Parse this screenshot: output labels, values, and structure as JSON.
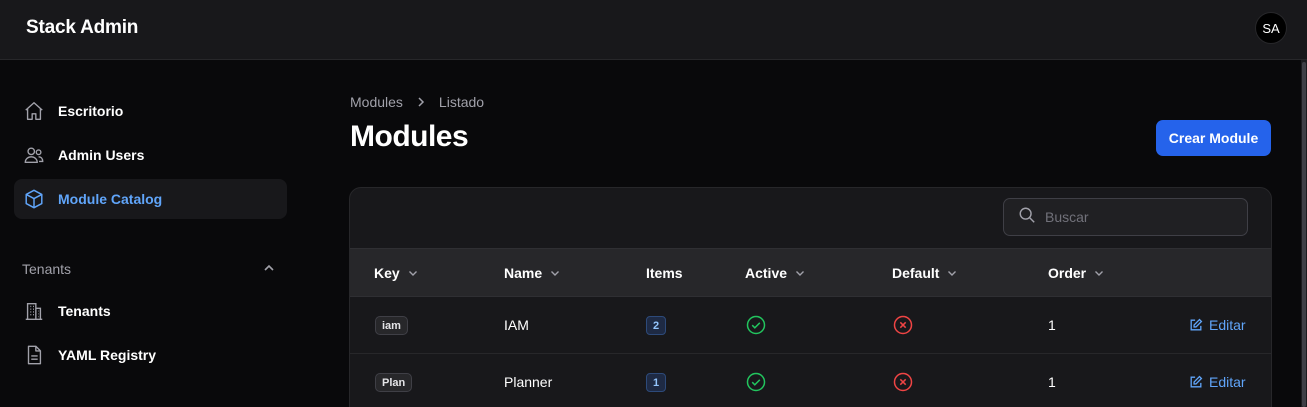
{
  "app": {
    "title": "Stack Admin",
    "avatar_initials": "SA"
  },
  "sidebar": {
    "items": [
      {
        "label": "Escritorio",
        "icon": "home-icon"
      },
      {
        "label": "Admin Users",
        "icon": "users-icon"
      },
      {
        "label": "Module Catalog",
        "icon": "cube-icon",
        "active": true
      }
    ],
    "group": {
      "label": "Tenants",
      "expanded": true,
      "items": [
        {
          "label": "Tenants",
          "icon": "building-icon"
        },
        {
          "label": "YAML Registry",
          "icon": "document-icon"
        }
      ]
    }
  },
  "breadcrumb": {
    "parent": "Modules",
    "current": "Listado"
  },
  "page": {
    "title": "Modules",
    "create_label": "Crear Module"
  },
  "search": {
    "placeholder": "Buscar",
    "value": ""
  },
  "table": {
    "columns": [
      {
        "label": "Key",
        "sortable": true
      },
      {
        "label": "Name",
        "sortable": true
      },
      {
        "label": "Items",
        "sortable": false
      },
      {
        "label": "Active",
        "sortable": true
      },
      {
        "label": "Default",
        "sortable": true
      },
      {
        "label": "Order",
        "sortable": true
      }
    ],
    "rows": [
      {
        "key": "iam",
        "name": "IAM",
        "items": "2",
        "active": true,
        "default": false,
        "order": "1",
        "action": "Editar"
      },
      {
        "key": "Plan",
        "name": "Planner",
        "items": "1",
        "active": true,
        "default": false,
        "order": "1",
        "action": "Editar"
      }
    ]
  },
  "colors": {
    "accent": "#2563eb",
    "link": "#60a5fa",
    "success": "#22c55e",
    "danger": "#ef4444"
  }
}
